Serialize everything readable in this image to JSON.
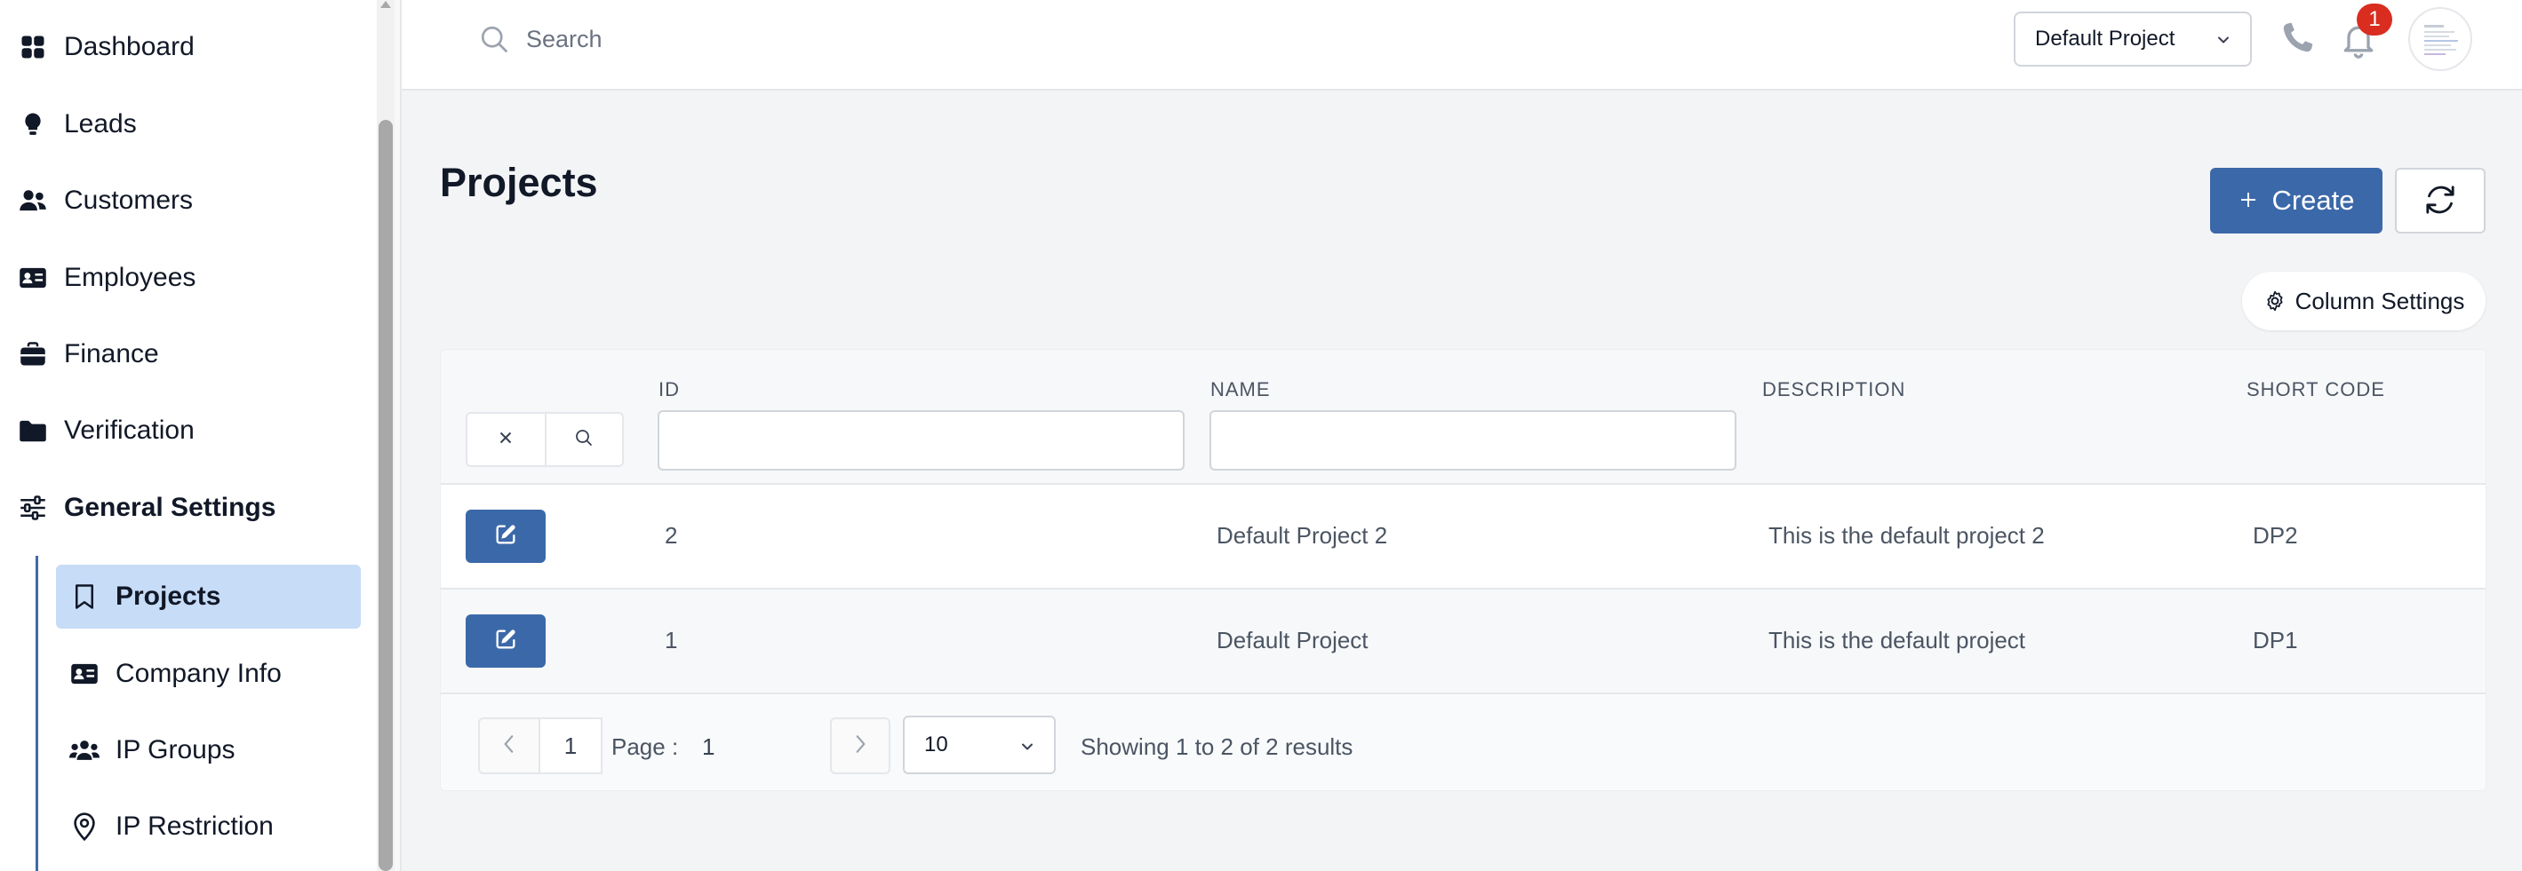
{
  "sidebar": {
    "items": [
      {
        "label": "Dashboard",
        "icon": "dashboard-icon"
      },
      {
        "label": "Leads",
        "icon": "lightbulb-icon"
      },
      {
        "label": "Customers",
        "icon": "users-icon"
      },
      {
        "label": "Employees",
        "icon": "id-card-icon"
      },
      {
        "label": "Finance",
        "icon": "briefcase-icon"
      },
      {
        "label": "Verification",
        "icon": "folder-icon"
      },
      {
        "label": "General Settings",
        "icon": "sliders-icon"
      }
    ],
    "sub_items": [
      {
        "label": "Projects",
        "icon": "bookmark-icon",
        "active": true
      },
      {
        "label": "Company Info",
        "icon": "id-card-icon"
      },
      {
        "label": "IP Groups",
        "icon": "users-icon"
      },
      {
        "label": "IP Restriction",
        "icon": "map-pin-icon"
      }
    ]
  },
  "topbar": {
    "search_placeholder": "Search",
    "project_select": "Default Project",
    "notification_count": "1"
  },
  "main": {
    "title": "Projects",
    "create_label": "Create",
    "column_settings_label": "Column Settings",
    "accent_color": "#3b68a8"
  },
  "table": {
    "columns": [
      "ID",
      "NAME",
      "DESCRIPTION",
      "SHORT CODE"
    ],
    "rows": [
      {
        "id": "2",
        "name": "Default Project 2",
        "description": "This is the default project 2",
        "short_code": "DP2"
      },
      {
        "id": "1",
        "name": "Default Project",
        "description": "This is the default project",
        "short_code": "DP1"
      }
    ]
  },
  "pagination": {
    "page_input": "1",
    "page_label": "Page :",
    "current_page": "1",
    "page_size": "10",
    "summary": "Showing 1 to 2 of 2 results"
  }
}
